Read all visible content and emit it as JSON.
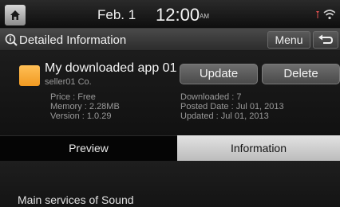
{
  "status_bar": {
    "date": "Feb.  1",
    "time": "12:00",
    "ampm": "AM"
  },
  "header": {
    "title": "Detailed Information",
    "menu_label": "Menu"
  },
  "app": {
    "name": "My downloaded app 01",
    "seller": "seller01 Co.",
    "update_label": "Update",
    "delete_label": "Delete",
    "price": "Price : Free",
    "memory": "Memory : 2.28MB",
    "version": "Version : 1.0.29",
    "downloaded": "Downloaded : 7",
    "posted_date": "Posted Date : Jul 01, 2013",
    "updated": "Updated : Jul 01, 2013",
    "icon_color": "#f5a830"
  },
  "tabs": {
    "preview_label": "Preview",
    "information_label": "Information",
    "active": "Information"
  },
  "content": {
    "text": "Main services of Sound"
  }
}
